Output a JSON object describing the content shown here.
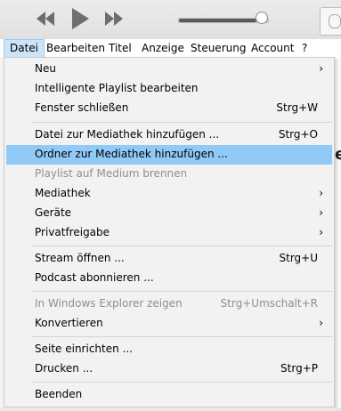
{
  "menubar": {
    "items": [
      "Datei",
      "Bearbeiten",
      "Titel",
      "Anzeige",
      "Steuerung",
      "Account",
      "?"
    ]
  },
  "background_text": "e",
  "datei_menu": {
    "items": [
      {
        "label": "Neu",
        "shortcut": "",
        "submenu": true,
        "disabled": false
      },
      {
        "label": "Intelligente Playlist bearbeiten",
        "shortcut": "",
        "submenu": false,
        "disabled": false
      },
      {
        "label": "Fenster schließen",
        "shortcut": "Strg+W",
        "submenu": false,
        "disabled": false
      },
      {
        "label": "Datei zur Mediathek hinzufügen ...",
        "shortcut": "Strg+O",
        "submenu": false,
        "disabled": false
      },
      {
        "label": "Ordner zur Mediathek hinzufügen ...",
        "shortcut": "",
        "submenu": false,
        "disabled": false,
        "highlighted": true
      },
      {
        "label": "Playlist auf Medium brennen",
        "shortcut": "",
        "submenu": false,
        "disabled": true
      },
      {
        "label": "Mediathek",
        "shortcut": "",
        "submenu": true,
        "disabled": false
      },
      {
        "label": "Geräte",
        "shortcut": "",
        "submenu": true,
        "disabled": false
      },
      {
        "label": "Privatfreigabe",
        "shortcut": "",
        "submenu": true,
        "disabled": false
      },
      {
        "label": "Stream öffnen ...",
        "shortcut": "Strg+U",
        "submenu": false,
        "disabled": false
      },
      {
        "label": "Podcast abonnieren ...",
        "shortcut": "",
        "submenu": false,
        "disabled": false
      },
      {
        "label": "In Windows Explorer zeigen",
        "shortcut": "Strg+Umschalt+R",
        "submenu": false,
        "disabled": true
      },
      {
        "label": "Konvertieren",
        "shortcut": "",
        "submenu": true,
        "disabled": false
      },
      {
        "label": "Seite einrichten ...",
        "shortcut": "",
        "submenu": false,
        "disabled": false
      },
      {
        "label": "Drucken ...",
        "shortcut": "Strg+P",
        "submenu": false,
        "disabled": false
      },
      {
        "label": "Beenden",
        "shortcut": "",
        "submenu": false,
        "disabled": false
      }
    ],
    "submenu_arrow": "›"
  },
  "playback": {
    "volume": 0.87
  },
  "colors": {
    "highlight": "#91c9f7",
    "active_menu": "#cce4f7",
    "disabled_text": "#8f8f8f"
  }
}
